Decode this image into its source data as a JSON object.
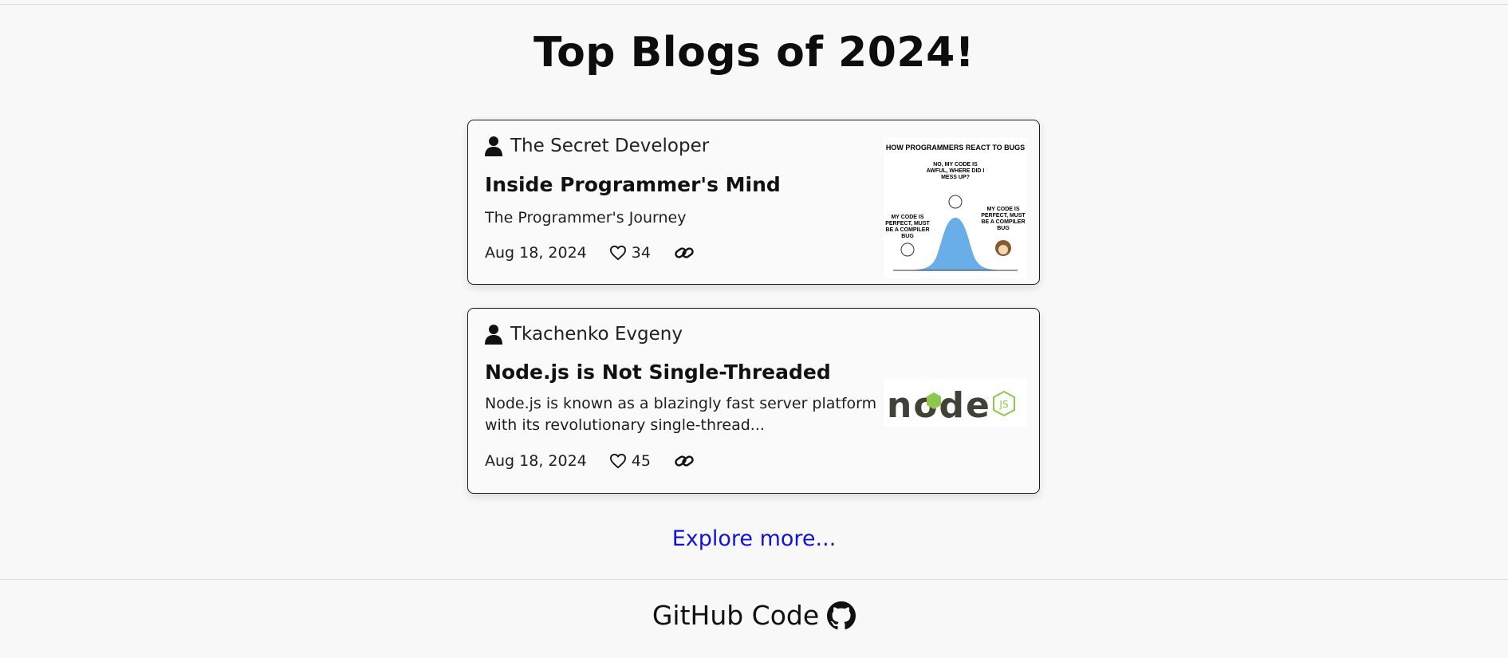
{
  "page": {
    "title": "Top Blogs of 2024!",
    "explore_label": "Explore more...",
    "footer_label": "GitHub Code"
  },
  "colors": {
    "background": "#f8f8f8",
    "link": "#1212dd",
    "card_border": "#1a1a1a",
    "node_green": "#8cc84b",
    "node_dark": "#404137"
  },
  "blogs": [
    {
      "author": "The Secret Developer",
      "title": "Inside Programmer's Mind",
      "description": "The Programmer's Journey",
      "date": "Aug 18, 2024",
      "likes": "34",
      "author_icon": "person-icon",
      "like_icon": "heart-icon",
      "link_icon": "link-icon",
      "thumbnail": {
        "heading": "HOW PROGRAMMERS REACT TO BUGS",
        "left_caption": "MY CODE IS PERFECT, MUST BE A COMPILER BUG",
        "middle_caption": "NO, MY CODE IS AWFUL, WHERE DID I MESS UP?",
        "right_caption": "MY CODE IS PERFECT, MUST BE A COMPILER BUG"
      }
    },
    {
      "author": "Tkachenko Evgeny",
      "title": "Node.js is Not Single-Threaded",
      "description": "Node.js is known as a blazingly fast server platform with its revolutionary single-thread...",
      "date": "Aug 18, 2024",
      "likes": "45",
      "author_icon": "person-icon",
      "like_icon": "heart-icon",
      "link_icon": "link-icon",
      "thumbnail": {
        "logo_text": "node",
        "badge_text": "JS"
      }
    }
  ],
  "footer": {
    "icon": "github-icon"
  }
}
